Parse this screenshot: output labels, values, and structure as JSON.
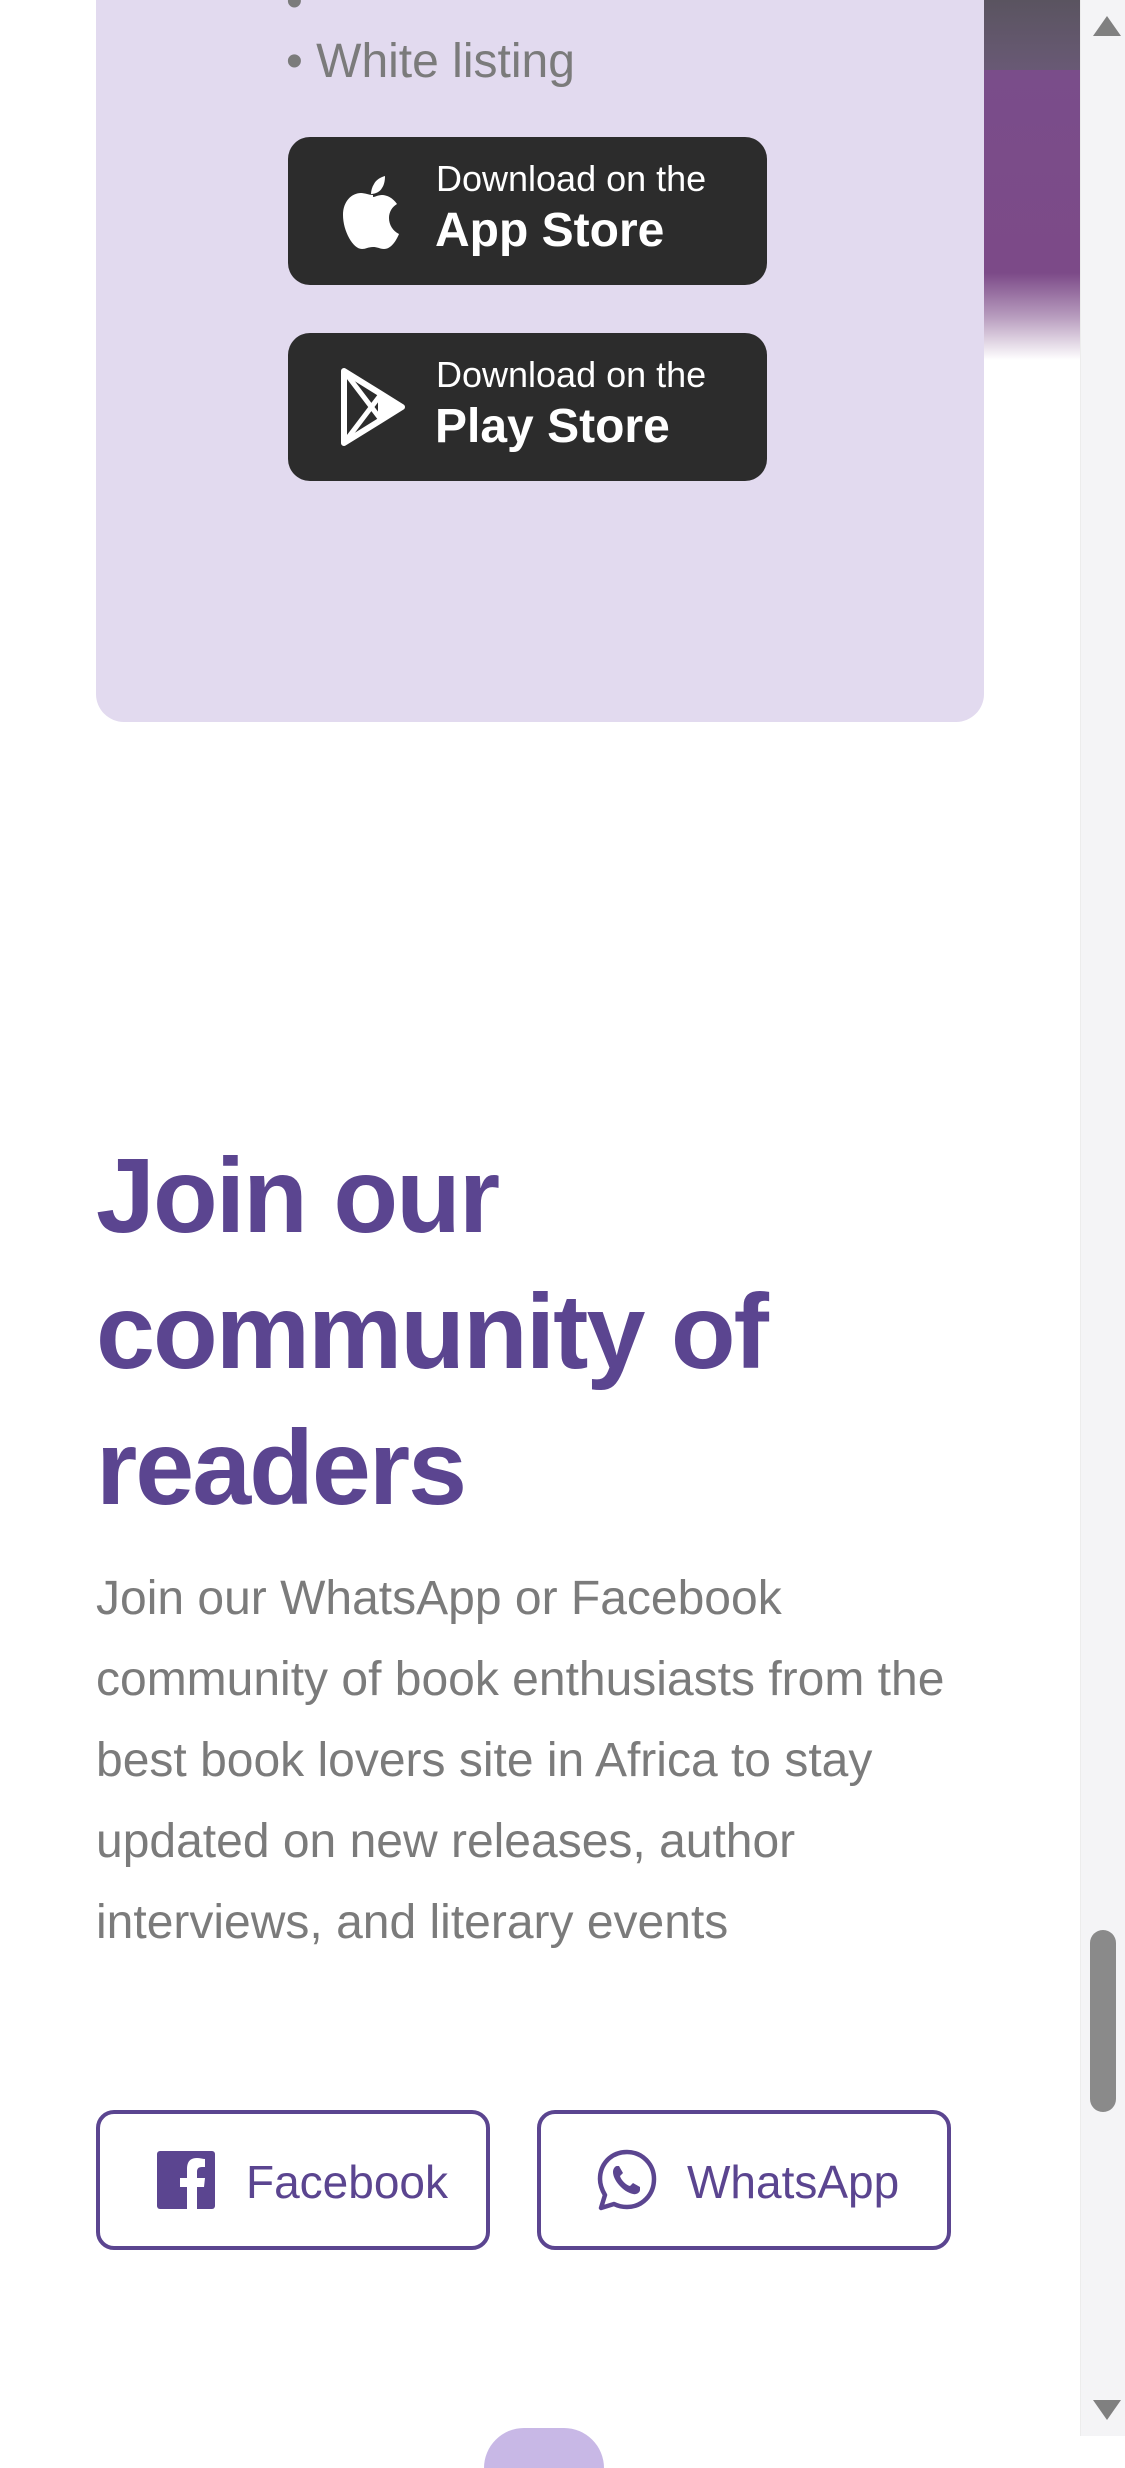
{
  "features": {
    "partial_item": "•",
    "last_item": "• White listing"
  },
  "app_store": {
    "small_text": "Download on the",
    "big_text": "App Store",
    "icon": "apple-icon"
  },
  "play_store": {
    "small_text": "Download on the",
    "big_text": "Play Store",
    "icon": "play-store-icon"
  },
  "community": {
    "title": "Join our community of readers",
    "description": "Join our WhatsApp or Facebook community of book enthusiasts from the best book lovers site in Africa to stay updated on new releases, author interviews, and literary events"
  },
  "social": {
    "facebook": {
      "label": "Facebook",
      "icon": "facebook-icon"
    },
    "whatsapp": {
      "label": "WhatsApp",
      "icon": "whatsapp-icon"
    }
  },
  "colors": {
    "accent": "#5b4590",
    "card_bg": "#e2daef",
    "button_dark": "#2c2c2c",
    "body_text": "#7b7b7b"
  }
}
